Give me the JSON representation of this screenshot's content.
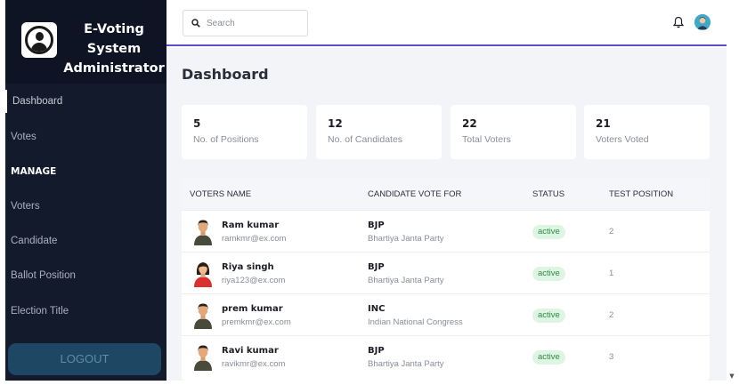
{
  "brand": {
    "title": "E-Voting System Administrator"
  },
  "sidebar": {
    "items": [
      {
        "label": "Dashboard",
        "active": true
      },
      {
        "label": "Votes"
      },
      {
        "label": "Voters"
      },
      {
        "label": "Candidate"
      },
      {
        "label": "Ballot Position"
      },
      {
        "label": "Election Title"
      }
    ],
    "manage_header": "MANAGE",
    "logout_label": "LOGOUT"
  },
  "search": {
    "placeholder": "Search",
    "value": ""
  },
  "main": {
    "title": "Dashboard"
  },
  "stats": [
    {
      "value": "5",
      "label": "No. of Positions"
    },
    {
      "value": "12",
      "label": "No. of Candidates"
    },
    {
      "value": "22",
      "label": "Total Voters"
    },
    {
      "value": "21",
      "label": "Voters Voted"
    }
  ],
  "table": {
    "headers": [
      "VOTERS NAME",
      "CANDIDATE VOTE FOR",
      "STATUS",
      "TEST POSITION"
    ],
    "rows": [
      {
        "name": "Ram kumar",
        "email": "ramkmr@ex.com",
        "party": "BJP",
        "party_name": "Bhartiya Janta Party",
        "status": "active",
        "position": "2",
        "avatar": "male"
      },
      {
        "name": "Riya singh",
        "email": "riya123@ex.com",
        "party": "BJP",
        "party_name": "Bhartiya Janta Party",
        "status": "active",
        "position": "1",
        "avatar": "female"
      },
      {
        "name": "prem kumar",
        "email": "premkmr@ex.com",
        "party": "INC",
        "party_name": "Indian National Congress",
        "status": "active",
        "position": "2",
        "avatar": "male"
      },
      {
        "name": "Ravi kumar",
        "email": "ravikmr@ex.com",
        "party": "BJP",
        "party_name": "Bhartiya Janta Party",
        "status": "active",
        "position": "3",
        "avatar": "male"
      }
    ]
  },
  "colors": {
    "sidebar": "#131a2c",
    "accent": "#5b4fc9",
    "status_bg": "#dff5e3",
    "status_text": "#2d8a45",
    "logout": "#1e4763"
  }
}
